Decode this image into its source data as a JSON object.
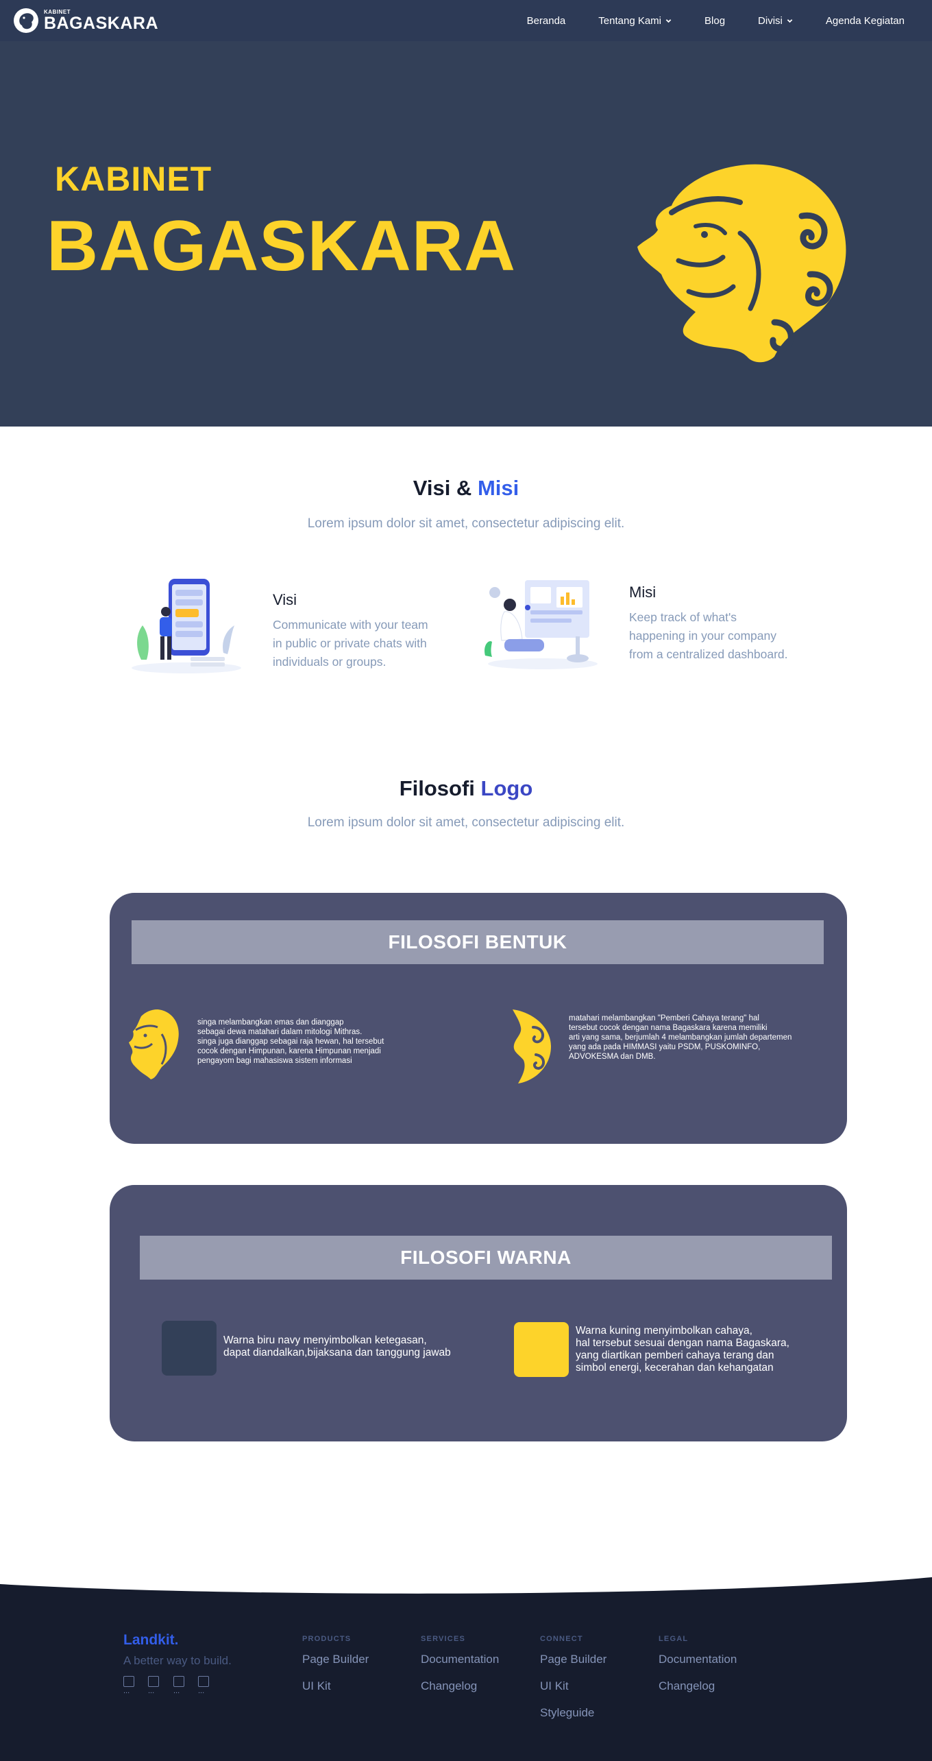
{
  "navbar": {
    "brand_small": "KABINET",
    "brand_big": "BAGASKARA",
    "items": [
      {
        "label": "Beranda",
        "dropdown": false
      },
      {
        "label": "Tentang Kami",
        "dropdown": true
      },
      {
        "label": "Blog",
        "dropdown": false
      },
      {
        "label": "Divisi",
        "dropdown": true
      },
      {
        "label": "Agenda Kegiatan",
        "dropdown": false
      }
    ]
  },
  "hero": {
    "title_small": "KABINET",
    "title_big": "BAGASKARA",
    "logo_icon": "lion-sun-logo-icon"
  },
  "visi_misi": {
    "title_main": "Visi &",
    "title_accent": "Misi",
    "subtitle": "Lorem ipsum dolor sit amet, consectetur adipiscing elit.",
    "visi": {
      "heading": "Visi",
      "text_lines": [
        "Communicate with your team",
        "in public or private chats with",
        "individuals or groups."
      ]
    },
    "misi": {
      "heading": "Misi",
      "text_lines": [
        "Keep track of what's",
        "happening in your company",
        "from a centralized dashboard."
      ]
    }
  },
  "filosofi": {
    "title_main": "Filosofi",
    "title_accent": "Logo",
    "subtitle": "Lorem ipsum dolor sit amet, consectetur adipiscing elit."
  },
  "bentuk": {
    "heading": "FILOSOFI BENTUK",
    "left_lines": [
      "singa melambangkan emas dan dianggap",
      "sebagai dewa matahari dalam mitologi Mithras.",
      "singa juga dianggap sebagai raja hewan, hal tersebut",
      "cocok dengan Himpunan, karena Himpunan menjadi",
      "pengayom bagi mahasiswa sistem informasi"
    ],
    "right_lines": [
      "matahari melambangkan \"Pemberi Cahaya terang\" hal",
      "tersebut cocok dengan nama Bagaskara karena memiliki",
      "arti yang sama, berjumlah 4 melambangkan jumlah departemen",
      "yang ada pada HIMMASI yaitu PSDM, PUSKOMINFO,",
      "ADVOKESMA dan DMB."
    ]
  },
  "warna": {
    "heading": "FILOSOFI  WARNA",
    "navy_color": "#334058",
    "yellow_color": "#fdd32a",
    "navy_lines": [
      "Warna biru navy menyimbolkan ketegasan,",
      "dapat diandalkan,bijaksana dan tanggung jawab"
    ],
    "yellow_lines": [
      "Warna kuning menyimbolkan cahaya,",
      "hal tersebut sesuai dengan nama Bagaskara,",
      "yang diartikan pemberi cahaya terang dan",
      "simbol energi, kecerahan dan kehangatan"
    ]
  },
  "footer": {
    "brand": "Landkit.",
    "tagline": "A better way to build.",
    "social_alt": [
      "...",
      "...",
      "...",
      "..."
    ],
    "columns": [
      {
        "head": "PRODUCTS",
        "links": [
          "Page Builder",
          "UI Kit"
        ]
      },
      {
        "head": "SERVICES",
        "links": [
          "Documentation",
          "Changelog"
        ]
      },
      {
        "head": "CONNECT",
        "links": [
          "Page Builder",
          "UI Kit",
          "Styleguide"
        ]
      },
      {
        "head": "LEGAL",
        "links": [
          "Documentation",
          "Changelog"
        ]
      }
    ]
  }
}
